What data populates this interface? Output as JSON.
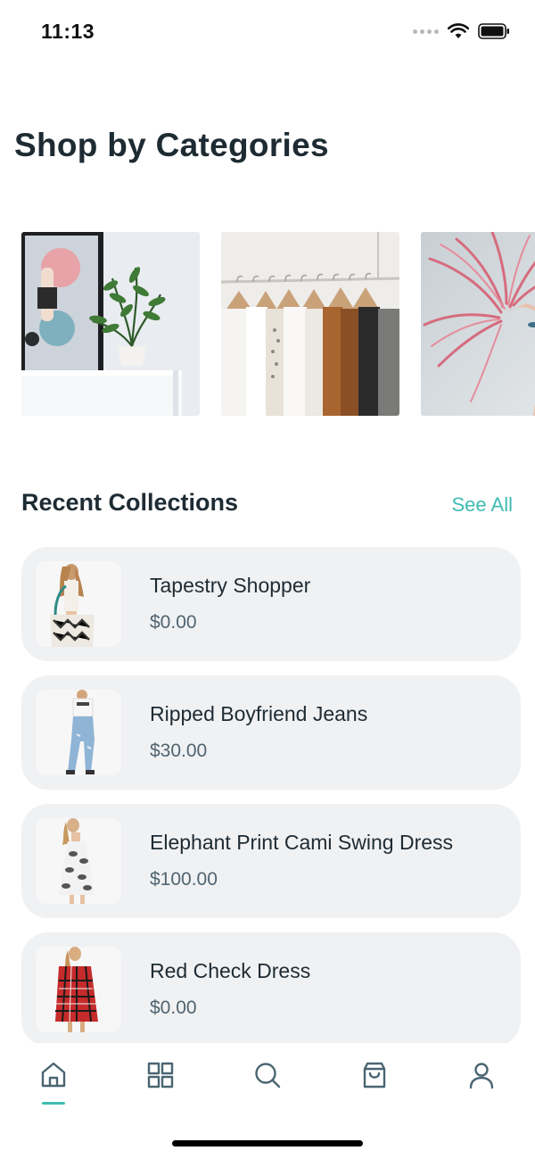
{
  "status_bar": {
    "time": "11:13"
  },
  "page_title": "Shop by Categories",
  "categories": [
    {
      "name": "home-decor-category-image"
    },
    {
      "name": "clothing-rack-category-image"
    },
    {
      "name": "hair-beauty-category-image"
    }
  ],
  "recent": {
    "title": "Recent Collections",
    "see_all": "See All",
    "items": [
      {
        "name": "Tapestry Shopper",
        "price": "$0.00"
      },
      {
        "name": "Ripped Boyfriend Jeans",
        "price": "$30.00"
      },
      {
        "name": "Elephant Print Cami Swing Dress",
        "price": "$100.00"
      },
      {
        "name": "Red Check Dress",
        "price": "$0.00"
      }
    ]
  },
  "bottom_nav": {
    "items": [
      "home-icon",
      "grid-icon",
      "search-icon",
      "shopping-bag-icon",
      "user-icon"
    ],
    "active": "home-icon"
  },
  "colors": {
    "accent": "#3fbcb2",
    "nav_icon": "#4a6572",
    "card_bg": "#f0f1f3"
  }
}
